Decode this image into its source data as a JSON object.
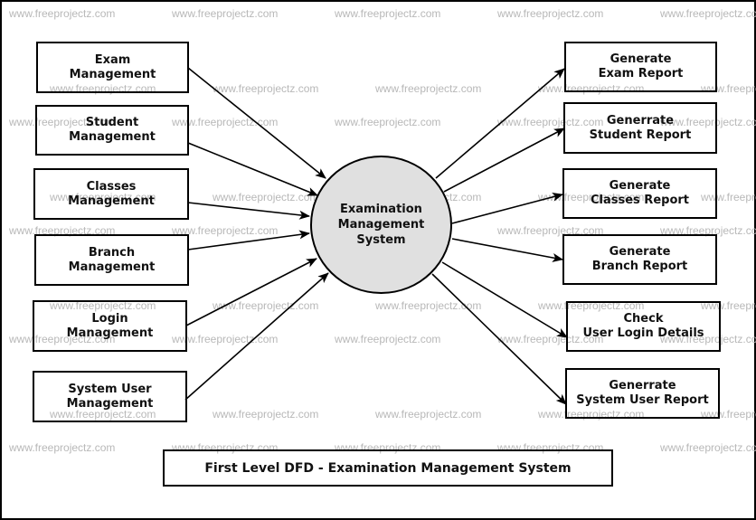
{
  "diagram": {
    "title": "First Level DFD - Examination Management System",
    "central_process": "Examination\nManagement\nSystem",
    "inputs": [
      {
        "label": "Exam\nManagement"
      },
      {
        "label": "Student\nManagement"
      },
      {
        "label": "Classes\nManagement"
      },
      {
        "label": "Branch\nManagement"
      },
      {
        "label": "Login\nManagement"
      },
      {
        "label": "System User\nManagement"
      }
    ],
    "outputs": [
      {
        "label": "Generate\nExam Report"
      },
      {
        "label": "Generrate\nStudent Report"
      },
      {
        "label": "Generate\nClasses Report"
      },
      {
        "label": "Generate\nBranch Report"
      },
      {
        "label": "Check\nUser Login Details"
      },
      {
        "label": "Generrate\nSystem User Report"
      }
    ],
    "watermark": "www.freeprojectz.com"
  }
}
